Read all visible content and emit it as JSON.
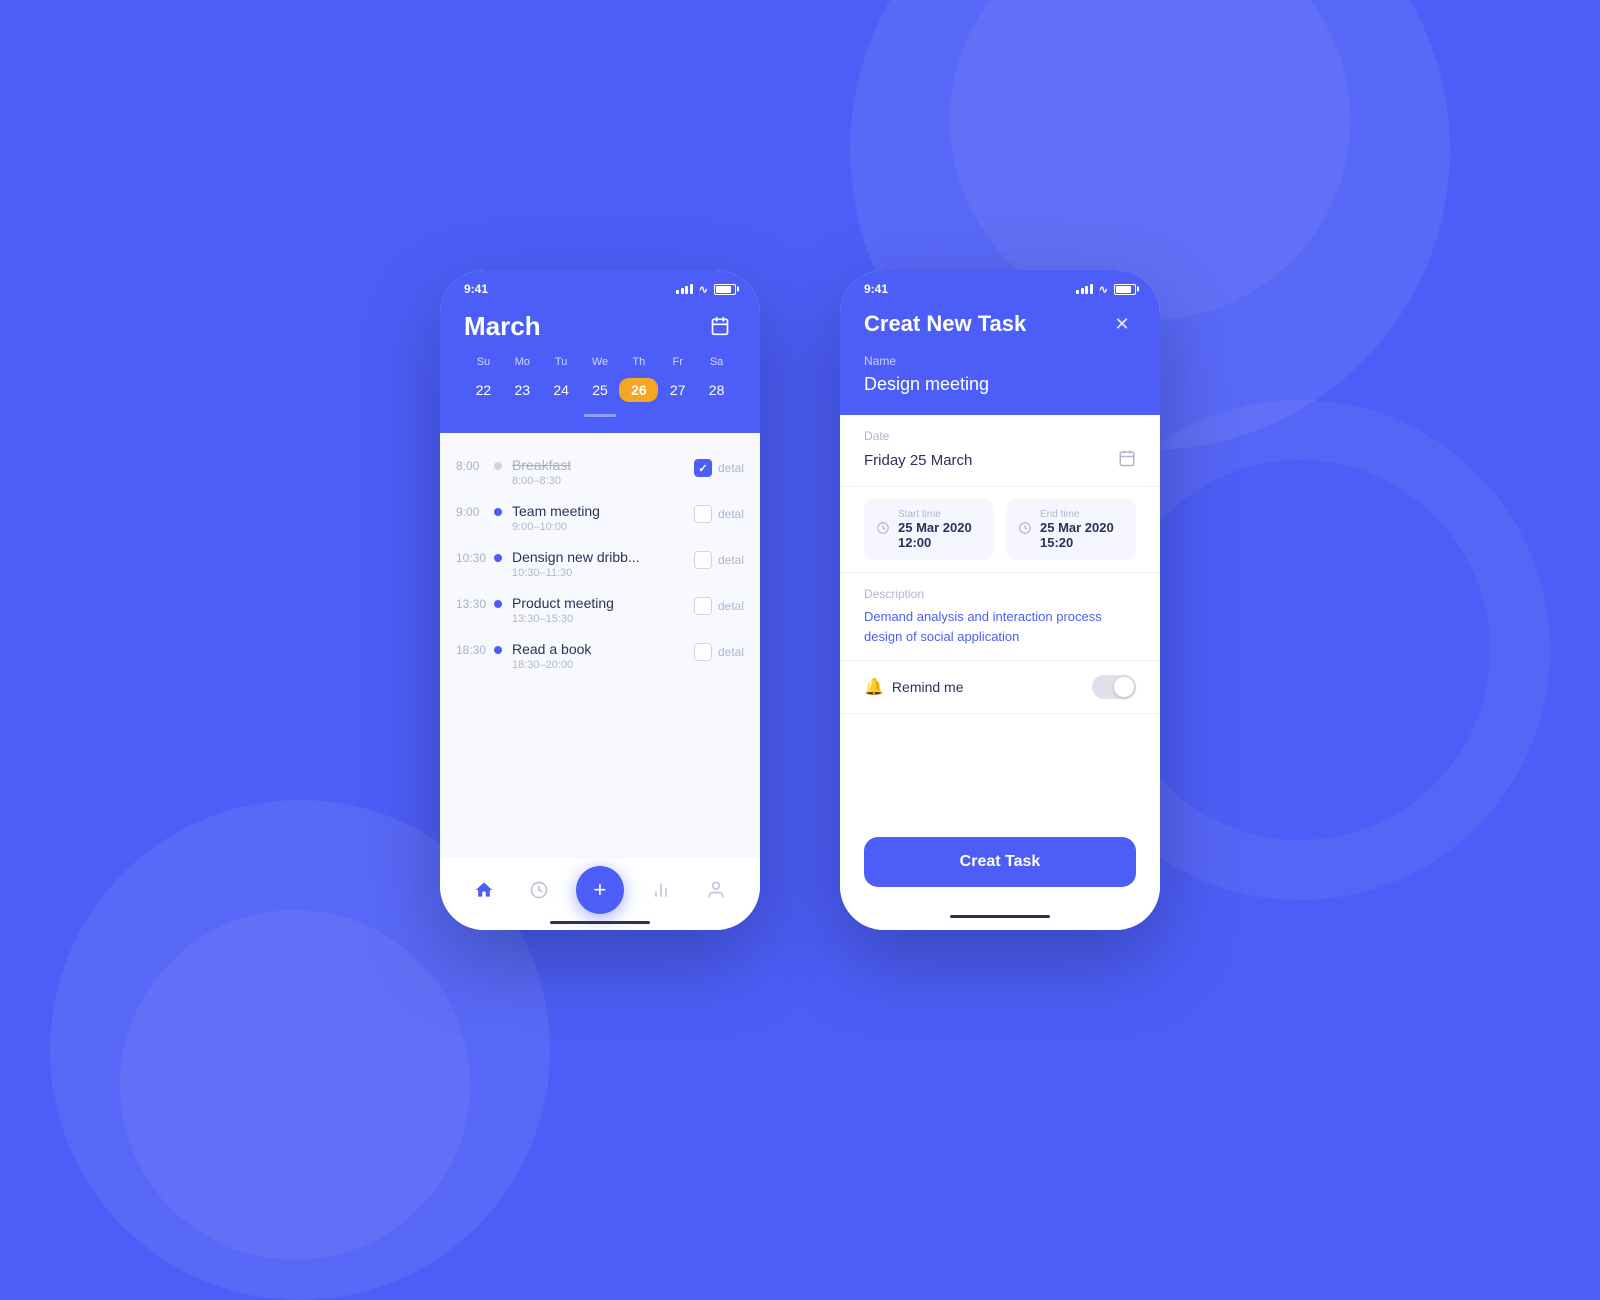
{
  "background_color": "#4c5ef7",
  "phone1": {
    "status_bar": {
      "time": "9:41"
    },
    "header": {
      "month": "March"
    },
    "week_days": [
      "Su",
      "Mo",
      "Tu",
      "We",
      "Th",
      "Fr",
      "Sa"
    ],
    "week_dates": [
      "22",
      "23",
      "24",
      "25",
      "26",
      "27",
      "28"
    ],
    "active_date": "26",
    "tasks": [
      {
        "time": "8:00",
        "name": "Breakfast",
        "range": "8:00–8:30",
        "completed": true,
        "checked": true
      },
      {
        "time": "9:00",
        "name": "Team meeting",
        "range": "9:00–10:00",
        "completed": false,
        "checked": false
      },
      {
        "time": "10:30",
        "name": "Densign new dribb...",
        "range": "10:30–11:30",
        "completed": false,
        "checked": false
      },
      {
        "time": "13:30",
        "name": "Product meeting",
        "range": "13:30–15:30",
        "completed": false,
        "checked": false
      },
      {
        "time": "18:30",
        "name": "Read a book",
        "range": "18:30–20:00",
        "completed": false,
        "checked": false
      }
    ],
    "nav": {
      "home_label": "home",
      "clock_label": "clock",
      "add_label": "+",
      "chart_label": "chart",
      "user_label": "user"
    }
  },
  "phone2": {
    "status_bar": {
      "time": "9:41"
    },
    "header": {
      "title": "Creat New Task",
      "close_label": "✕",
      "name_label": "Name",
      "name_value": "Design meeting"
    },
    "date_section": {
      "label": "Date",
      "value": "Friday 25 March"
    },
    "start_time": {
      "label": "Start time",
      "value": "25 Mar 2020  12:00"
    },
    "end_time": {
      "label": "End time",
      "value": "25 Mar 2020  15:20"
    },
    "description": {
      "label": "Description",
      "value": "Demand analysis and interaction process design of social application"
    },
    "remind": {
      "label": "Remind me"
    },
    "create_button": "Creat Task"
  }
}
